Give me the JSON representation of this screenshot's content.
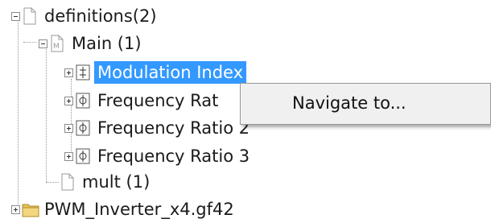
{
  "tree": {
    "definitions": {
      "label": "definitions(2)"
    },
    "main": {
      "label": "Main (1)"
    },
    "modulation_index": {
      "label": "Modulation Index"
    },
    "freq_ratio_1": {
      "label": "Frequency Rat"
    },
    "freq_ratio_2": {
      "label": "Frequency Ratio 2"
    },
    "freq_ratio_3": {
      "label": "Frequency Ratio 3"
    },
    "mult": {
      "label": "mult (1)"
    },
    "pwm_inverter": {
      "label": "PWM_Inverter_x4.gf42"
    }
  },
  "context_menu": {
    "items": [
      {
        "label": "Navigate to..."
      }
    ]
  },
  "colors": {
    "selection": "#3399ff",
    "menu_bg": "#f0f0f0",
    "folder": "#e8c35a"
  },
  "icons": {
    "document": "document-icon",
    "main_module": "module-doc-icon",
    "modulation": "modulation-node-icon",
    "frequency": "phi-node-icon",
    "folder": "folder-icon"
  }
}
